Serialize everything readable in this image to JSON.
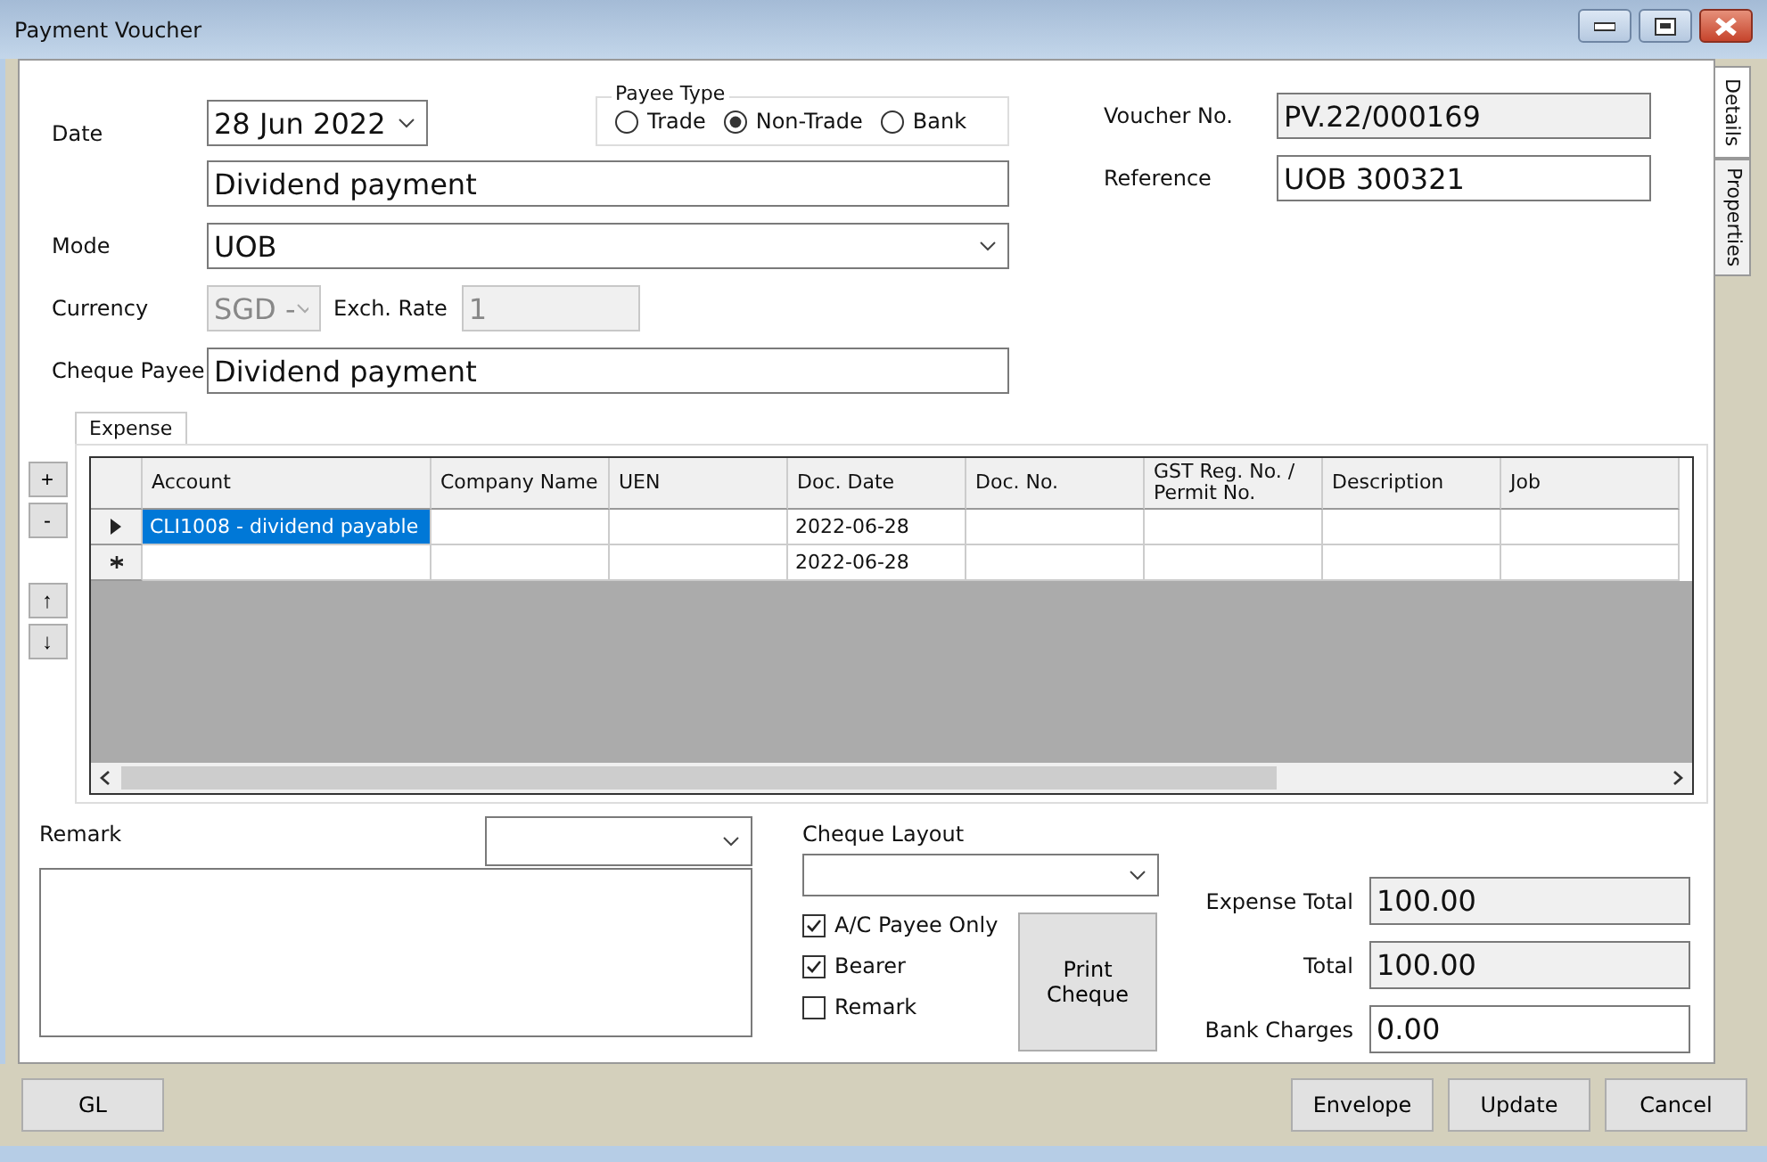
{
  "window": {
    "title": "Payment Voucher"
  },
  "form": {
    "date": {
      "label": "Date",
      "value": "28 Jun  2022"
    },
    "payee_type": {
      "label": "Payee Type",
      "options": [
        {
          "label": "Trade",
          "selected": false
        },
        {
          "label": "Non-Trade",
          "selected": true
        },
        {
          "label": "Bank",
          "selected": false
        }
      ]
    },
    "description": {
      "value": "Dividend payment"
    },
    "mode": {
      "label": "Mode",
      "value": "UOB"
    },
    "currency": {
      "label": "Currency",
      "value": "SGD -",
      "disabled": true
    },
    "exch_rate": {
      "label": "Exch. Rate",
      "value": "1",
      "disabled": true
    },
    "cheque_payee": {
      "label": "Cheque Payee",
      "value": "Dividend payment"
    },
    "voucher_no": {
      "label": "Voucher No.",
      "value": "PV.22/000169",
      "disabled": true
    },
    "reference": {
      "label": "Reference",
      "value": "UOB 300321",
      "disabled": false
    }
  },
  "side_tabs": [
    {
      "label": "Details",
      "selected": true
    },
    {
      "label": "Properties",
      "selected": false
    }
  ],
  "grid": {
    "tab": "Expense",
    "row_buttons": [
      "+",
      "-",
      "↑",
      "↓"
    ],
    "columns": [
      "Account",
      "Company Name",
      "UEN",
      "Doc. Date",
      "Doc. No.",
      "GST Reg. No. / Permit No.",
      "Description",
      "Job"
    ],
    "rows": [
      {
        "kind": "current",
        "cells": [
          {
            "text": "CLI1008 - dividend payable",
            "selected": true
          },
          {
            "text": "",
            "selected": false
          },
          {
            "text": "",
            "selected": false
          },
          {
            "text": "2022-06-28",
            "selected": false
          },
          {
            "text": "",
            "selected": false
          },
          {
            "text": "",
            "selected": false
          },
          {
            "text": "",
            "selected": false
          },
          {
            "text": "",
            "selected": false
          }
        ]
      },
      {
        "kind": "new",
        "cells": [
          {
            "text": "",
            "selected": false
          },
          {
            "text": "",
            "selected": false
          },
          {
            "text": "",
            "selected": false
          },
          {
            "text": "2022-06-28",
            "selected": false
          },
          {
            "text": "",
            "selected": false
          },
          {
            "text": "",
            "selected": false
          },
          {
            "text": "",
            "selected": false
          },
          {
            "text": "",
            "selected": false
          }
        ]
      }
    ]
  },
  "remark": {
    "label": "Remark"
  },
  "cheque": {
    "label": "Cheque Layout",
    "options": [
      {
        "label": "A/C Payee Only",
        "checked": true
      },
      {
        "label": "Bearer",
        "checked": true
      },
      {
        "label": "Remark",
        "checked": false
      }
    ],
    "print_button": "Print Cheque"
  },
  "totals": [
    {
      "label": "Expense Total",
      "value": "100.00",
      "disabled": true
    },
    {
      "label": "Total",
      "value": "100.00",
      "disabled": true
    },
    {
      "label": "Bank Charges",
      "value": "0.00",
      "disabled": false
    }
  ],
  "footer": {
    "left_button": "GL",
    "right_buttons": [
      "Envelope",
      "Update",
      "Cancel"
    ]
  }
}
